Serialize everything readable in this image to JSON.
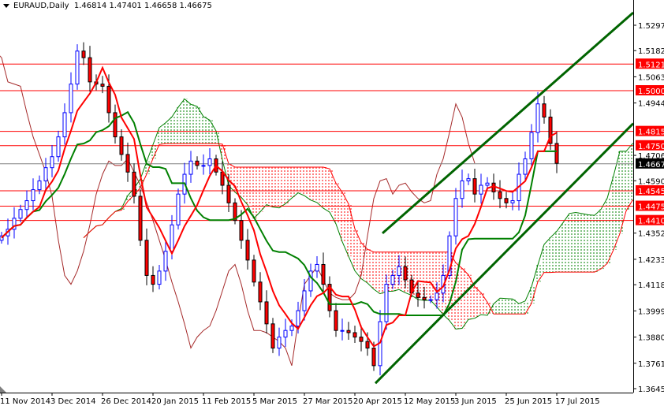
{
  "header": {
    "symbol": "EURAUD,Daily",
    "open": "1.46814",
    "high": "1.47401",
    "low": "1.46658",
    "close": "1.46675"
  },
  "chart_data": {
    "type": "candlestick",
    "title": "EURAUD,Daily",
    "ylim": [
      1.36455,
      1.52975
    ],
    "grid": false,
    "price_ticks": [
      "1.52975",
      "1.51820",
      "1.50630",
      "1.49440",
      "1.47060",
      "1.45905",
      "1.43525",
      "1.42335",
      "1.41180",
      "1.39990",
      "1.38800",
      "1.37610",
      "1.36455"
    ],
    "date_ticks": [
      "11 Nov 2014",
      "3 Dec 2014",
      "26 Dec 2014",
      "20 Jan 2015",
      "11 Feb 2015",
      "5 Mar 2015",
      "27 Mar 2015",
      "20 Apr 2015",
      "12 May 2015",
      "3 Jun 2015",
      "25 Jun 2015",
      "17 Jul 2015"
    ],
    "closes": [
      1.434,
      1.437,
      1.442,
      1.446,
      1.45,
      1.455,
      1.459,
      1.465,
      1.47,
      1.479,
      1.49,
      1.503,
      1.518,
      1.515,
      1.504,
      1.503,
      1.502,
      1.49,
      1.479,
      1.471,
      1.463,
      1.452,
      1.432,
      1.416,
      1.412,
      1.418,
      1.427,
      1.439,
      1.453,
      1.462,
      1.468,
      1.466,
      1.466,
      1.469,
      1.463,
      1.457,
      1.449,
      1.441,
      1.432,
      1.423,
      1.413,
      1.404,
      1.394,
      1.383,
      1.388,
      1.391,
      1.393,
      1.4,
      1.409,
      1.418,
      1.421,
      1.412,
      1.4,
      1.391,
      1.391,
      1.39,
      1.388,
      1.386,
      1.383,
      1.375,
      1.395,
      1.412,
      1.416,
      1.42,
      1.414,
      1.408,
      1.406,
      1.405,
      1.405,
      1.408,
      1.416,
      1.434,
      1.451,
      1.459,
      1.46,
      1.453,
      1.457,
      1.458,
      1.454,
      1.451,
      1.449,
      1.45,
      1.462,
      1.469,
      1.481,
      1.494,
      1.488,
      1.476,
      1.467
    ],
    "horizontal_levels": [
      {
        "price": "1.51210",
        "color": "#ff0000"
      },
      {
        "price": "1.50000",
        "color": "#ff0000"
      },
      {
        "price": "1.48150",
        "color": "#ff0000"
      },
      {
        "price": "1.47500",
        "color": "#ff0000"
      },
      {
        "price": "1.45450",
        "color": "#ff0000"
      },
      {
        "price": "1.44750",
        "color": "#ff0000"
      },
      {
        "price": "1.44100",
        "color": "#ff0000"
      }
    ],
    "current_price": {
      "price": "1.46675",
      "color": "#000000"
    },
    "channel_lines": [
      {
        "from": [
          "20 Apr 2015",
          1.4352
        ],
        "to": [
          "end",
          1.5355
        ],
        "color": "#006400"
      },
      {
        "from": [
          "20 Apr 2015",
          1.367
        ],
        "to": [
          "end",
          1.4851
        ],
        "color": "#006400"
      }
    ],
    "colors": {
      "bull": "#0000ff",
      "bear": "#ff0000",
      "tenkan": "#ff0000",
      "kijun": "#008000",
      "chikou": "#a52a2a",
      "cloud_up": "#008000",
      "cloud_down": "#ff0000"
    }
  }
}
